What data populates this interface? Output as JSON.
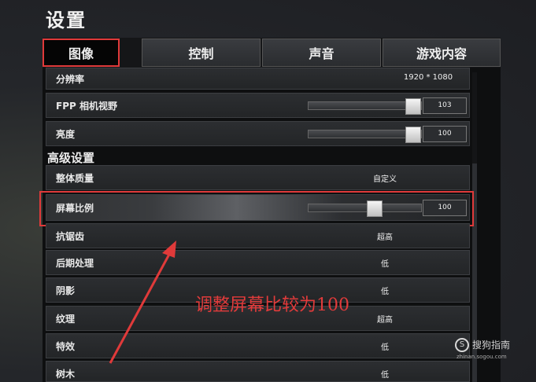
{
  "title": "设置",
  "tabs": [
    {
      "label": "图像",
      "active": true
    },
    {
      "label": "控制",
      "active": false
    },
    {
      "label": "声音",
      "active": false
    },
    {
      "label": "游戏内容",
      "active": false
    }
  ],
  "rows": {
    "resolution": {
      "label": "分辨率",
      "value": "1920 * 1080"
    },
    "fpp_fov": {
      "label": "FPP 相机视野",
      "value": "103",
      "level_percent": 100
    },
    "brightness": {
      "label": "亮度",
      "value": "100",
      "level_percent": 100
    },
    "overall_quality": {
      "label": "整体质量",
      "value": "自定义"
    },
    "screen_scale": {
      "label": "屏幕比例",
      "value": "100",
      "level_percent": 60
    },
    "anti_aliasing": {
      "label": "抗锯齿",
      "value": "超高"
    },
    "post_processing": {
      "label": "后期处理",
      "value": "低"
    },
    "shadows": {
      "label": "阴影",
      "value": "低"
    },
    "textures": {
      "label": "纹理",
      "value": "超高"
    },
    "effects": {
      "label": "特效",
      "value": "低"
    },
    "foliage": {
      "label": "树木",
      "value": "低"
    }
  },
  "section_advanced": "高级设置",
  "annotation": "调整屏幕比较为100",
  "watermark": {
    "name": "搜狗指南",
    "site": "zhinan.sogou.com"
  },
  "colors": {
    "highlight": "#e03a3a",
    "panel": "#0e0f10"
  }
}
